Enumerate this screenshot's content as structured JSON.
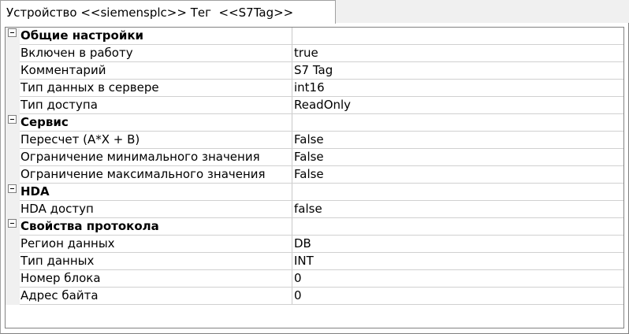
{
  "tab": {
    "label": "Устройство <<siemensplc>> Тег  <<S7Tag>>"
  },
  "property_grid": {
    "categories": [
      {
        "title": "Общие настройки",
        "properties": [
          {
            "name": "Включен в работу",
            "value": "true"
          },
          {
            "name": "Комментарий",
            "value": "S7 Tag"
          },
          {
            "name": "Тип данных в сервере",
            "value": "int16"
          },
          {
            "name": "Тип доступа",
            "value": "ReadOnly"
          }
        ]
      },
      {
        "title": "Сервис",
        "properties": [
          {
            "name": "Пересчет (A*X + B)",
            "value": "False"
          },
          {
            "name": "Ограничение минимального значения",
            "value": "False"
          },
          {
            "name": "Ограничение максимального значения",
            "value": "False"
          }
        ]
      },
      {
        "title": "HDA",
        "properties": [
          {
            "name": "HDA доступ",
            "value": "false"
          }
        ]
      },
      {
        "title": "Свойства протокола",
        "properties": [
          {
            "name": "Регион данных",
            "value": "DB"
          },
          {
            "name": "Тип данных",
            "value": "INT"
          },
          {
            "name": "Номер блока",
            "value": "0"
          },
          {
            "name": "Адрес байта",
            "value": "0"
          }
        ]
      }
    ]
  }
}
